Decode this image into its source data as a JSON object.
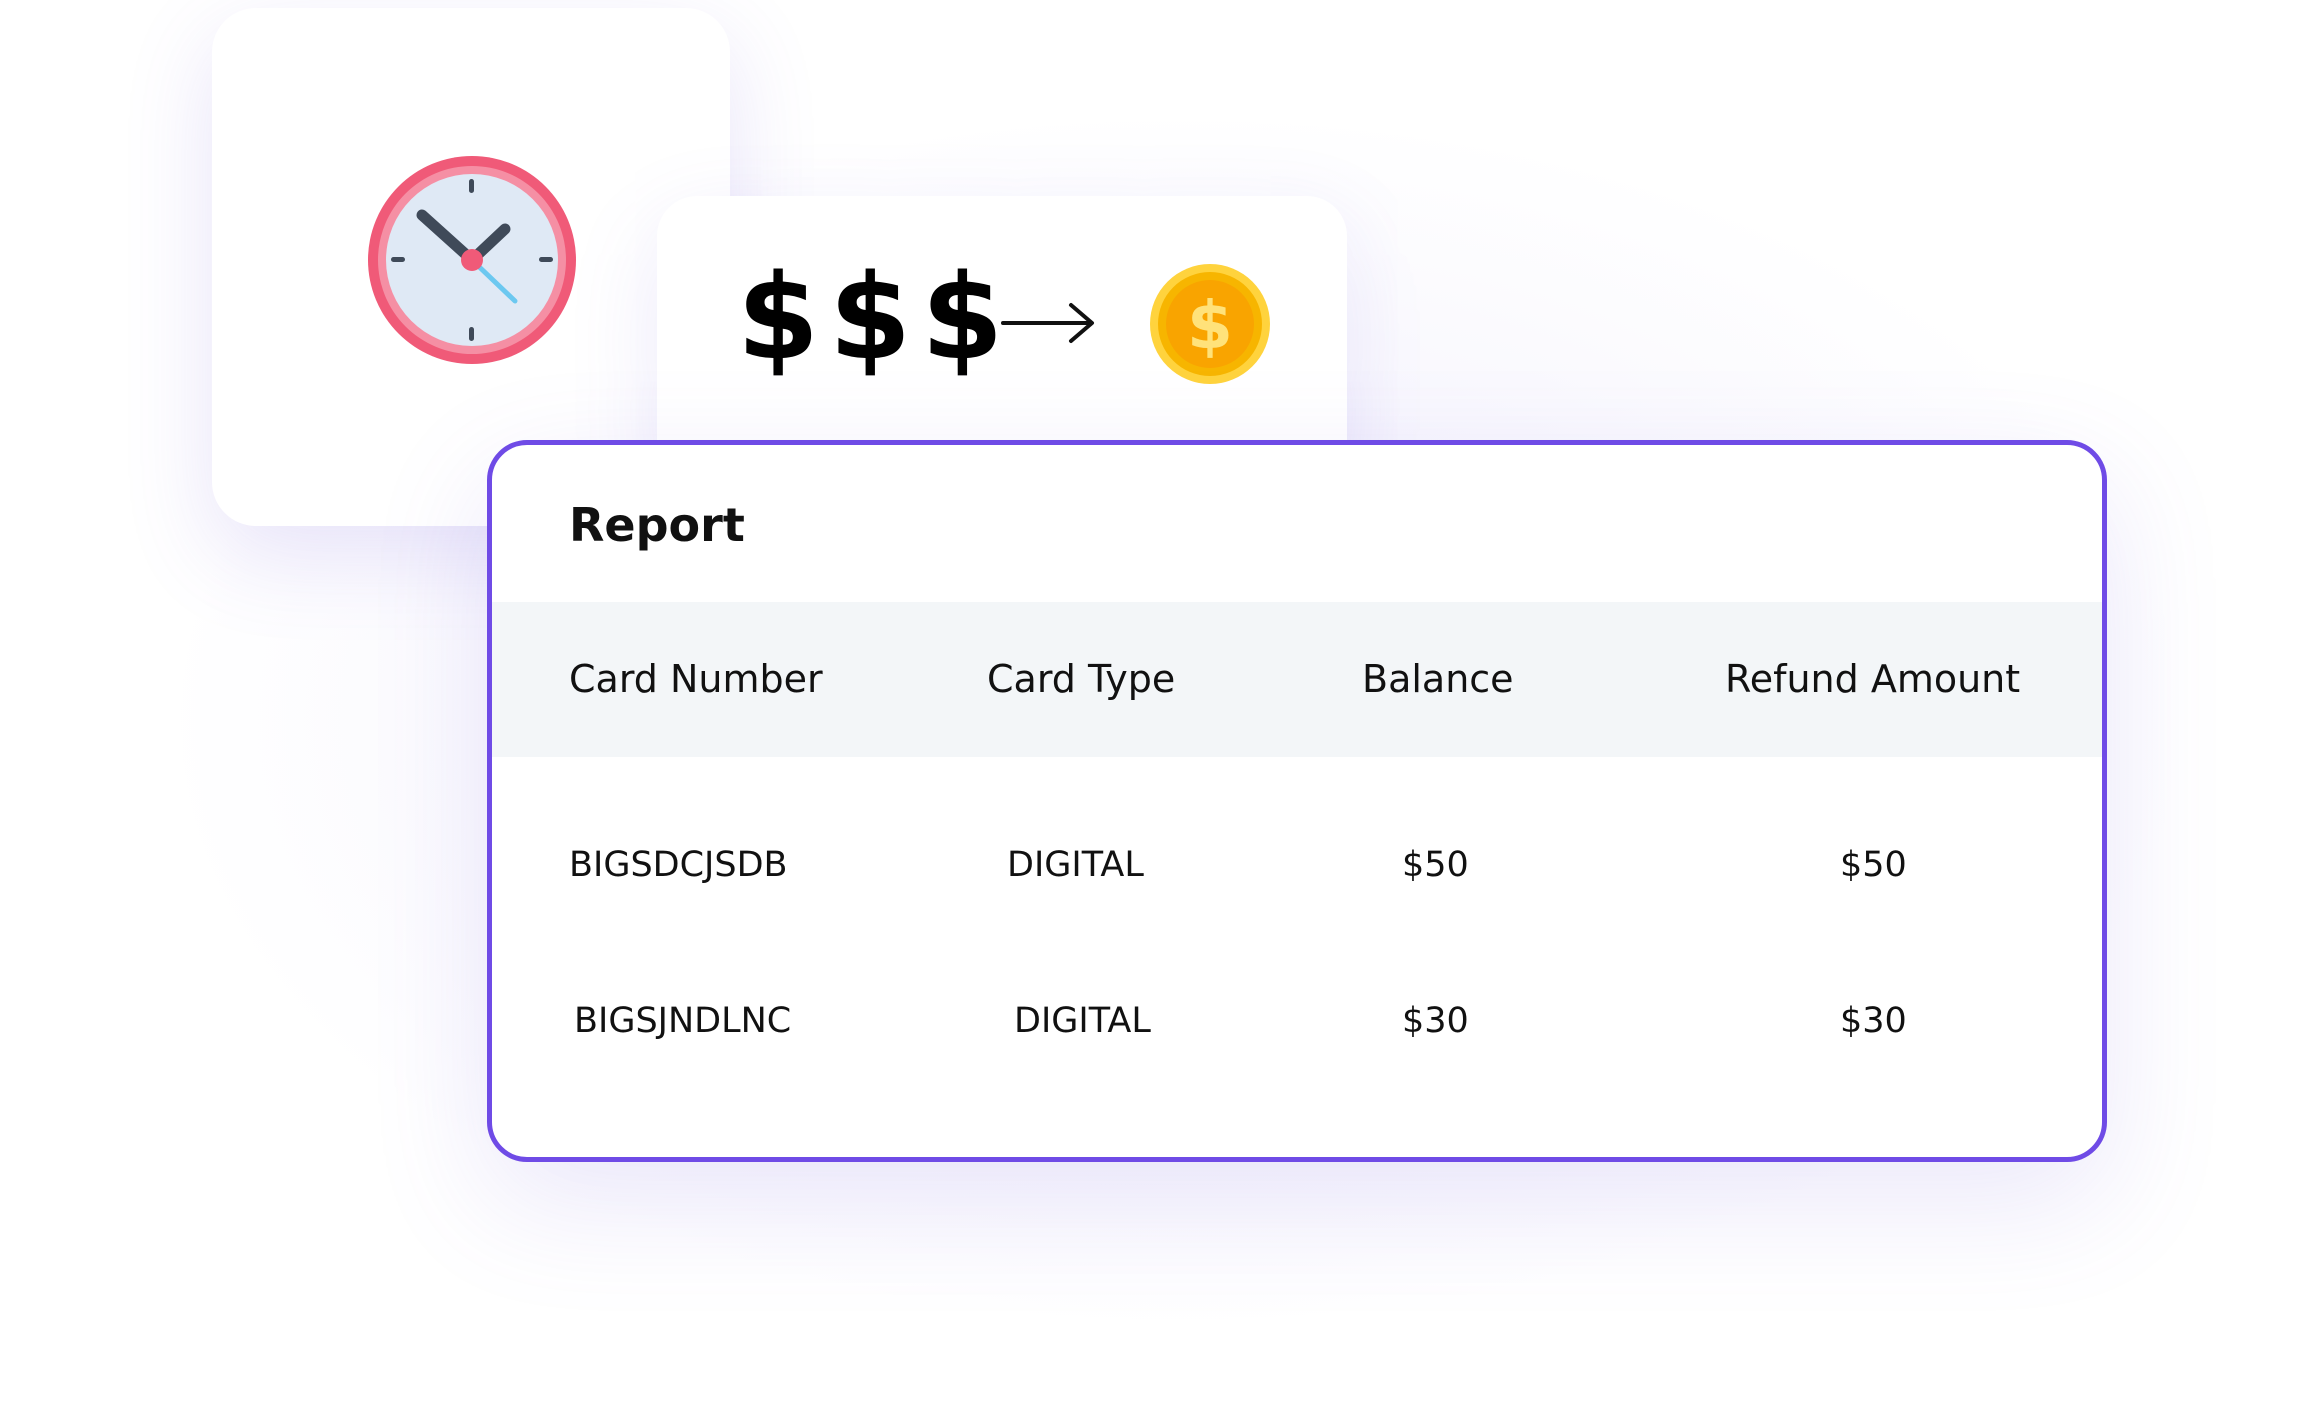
{
  "money_card": {
    "dollars_text": "$$$",
    "icons": [
      "arrow-right-icon",
      "gold-coin-icon"
    ]
  },
  "clock_card": {
    "icon": "clock-icon"
  },
  "report": {
    "title": "Report",
    "columns": [
      "Card Number",
      "Card Type",
      "Balance",
      "Refund Amount"
    ],
    "rows": [
      [
        "BIGSDCJSDB",
        "DIGITAL",
        "$50",
        "$50"
      ],
      [
        "BIGSJNDLNC",
        "DIGITAL",
        "$30",
        "$30"
      ]
    ]
  },
  "colors": {
    "accent": "#6f4be6",
    "clock_red": "#f05a78",
    "coin_gold": "#f7b500",
    "header_bg": "#f3f6f8"
  }
}
